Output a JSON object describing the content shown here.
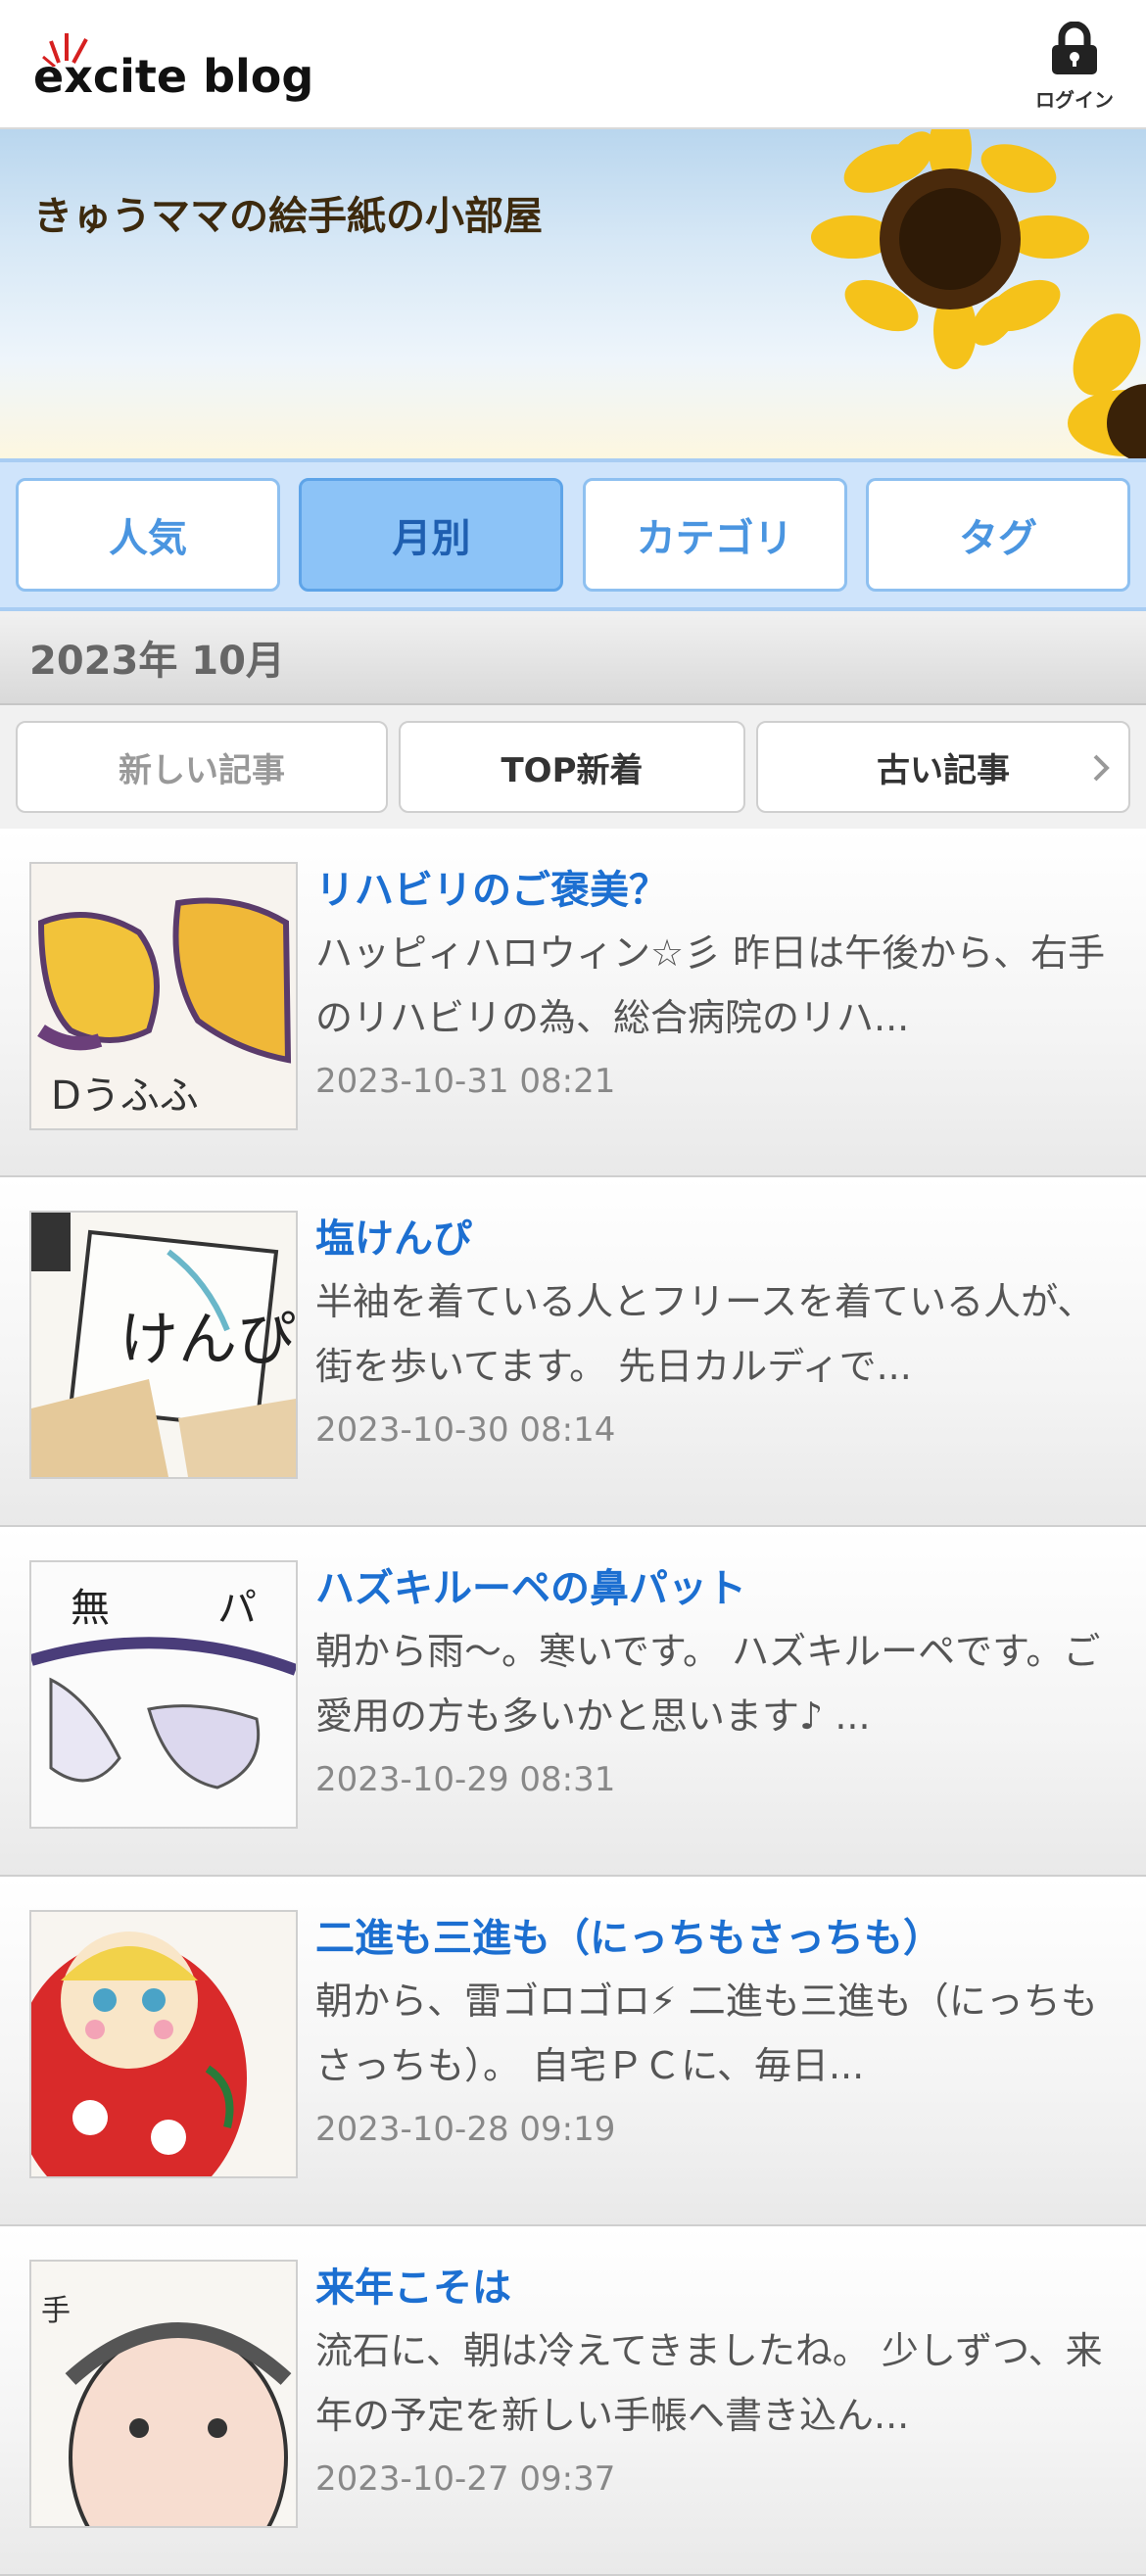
{
  "header": {
    "logo_text": "excite blog",
    "login_label": "ログイン",
    "login_icon": "lock-icon"
  },
  "banner": {
    "title": "きゅうママの絵手紙の小部屋"
  },
  "tabs": [
    {
      "label": "人気",
      "active": false
    },
    {
      "label": "月別",
      "active": true
    },
    {
      "label": "カテゴリ",
      "active": false
    },
    {
      "label": "タグ",
      "active": false
    }
  ],
  "month": "2023年 10月",
  "pager": {
    "newer": "新しい記事",
    "top": "TOP新着",
    "older": "古い記事",
    "older_icon": "chevron-right-icon"
  },
  "entries": [
    {
      "title": "リハビリのご褒美？",
      "excerpt": "ハッピィハロウィン☆彡 昨日は午後から、右手のリハビリの為、総合病院のリハ...",
      "date": "2023-10-31 08:21"
    },
    {
      "title": "塩けんぴ",
      "excerpt": "半袖を着ている人とフリースを着ている人が、街を歩いてます。 先日カルディで...",
      "date": "2023-10-30 08:14"
    },
    {
      "title": "ハズキルーペの鼻パット",
      "excerpt": "朝から雨〜。寒いです。 ハズキルーペです。ご愛用の方も多いかと思います♪ ...",
      "date": "2023-10-29 08:31"
    },
    {
      "title": "二進も三進も（にっちもさっちも）",
      "excerpt": "朝から、雷ゴロゴロ⚡ 二進も三進も（にっちもさっちも）。 自宅ＰＣに、毎日...",
      "date": "2023-10-28 09:19"
    },
    {
      "title": "来年こそは",
      "excerpt": "流石に、朝は冷えてきましたね。 少しずつ、来年の予定を新しい手帳へ書き込ん...",
      "date": "2023-10-27 09:37"
    }
  ]
}
